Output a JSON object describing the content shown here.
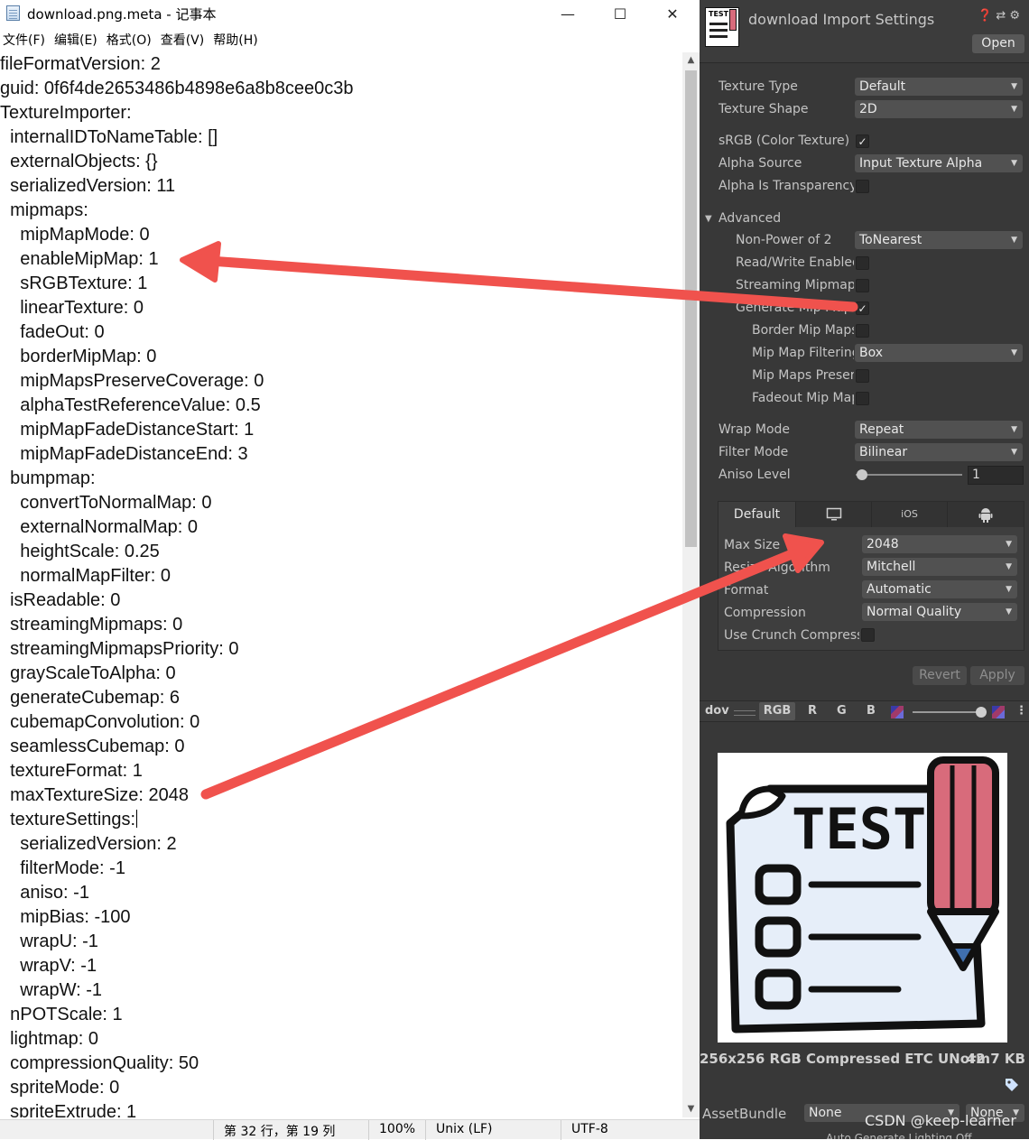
{
  "notepad": {
    "title": "download.png.meta - 记事本",
    "window_controls": {
      "minimize": "—",
      "maximize": "☐",
      "close": "✕"
    },
    "menu": [
      "文件(F)",
      "编辑(E)",
      "格式(O)",
      "查看(V)",
      "帮助(H)"
    ],
    "lines": [
      "fileFormatVersion: 2",
      "guid: 0f6f4de2653486b4898e6a8b8cee0c3b",
      "TextureImporter:",
      "  internalIDToNameTable: []",
      "  externalObjects: {}",
      "  serializedVersion: 11",
      "  mipmaps:",
      "    mipMapMode: 0",
      "    enableMipMap: 1",
      "    sRGBTexture: 1",
      "    linearTexture: 0",
      "    fadeOut: 0",
      "    borderMipMap: 0",
      "    mipMapsPreserveCoverage: 0",
      "    alphaTestReferenceValue: 0.5",
      "    mipMapFadeDistanceStart: 1",
      "    mipMapFadeDistanceEnd: 3",
      "  bumpmap:",
      "    convertToNormalMap: 0",
      "    externalNormalMap: 0",
      "    heightScale: 0.25",
      "    normalMapFilter: 0",
      "  isReadable: 0",
      "  streamingMipmaps: 0",
      "  streamingMipmapsPriority: 0",
      "  grayScaleToAlpha: 0",
      "  generateCubemap: 6",
      "  cubemapConvolution: 0",
      "  seamlessCubemap: 0",
      "  textureFormat: 1",
      "  maxTextureSize: 2048",
      "  textureSettings:",
      "    serializedVersion: 2",
      "    filterMode: -1",
      "    aniso: -1",
      "    mipBias: -100",
      "    wrapU: -1",
      "    wrapV: -1",
      "    wrapW: -1",
      "  nPOTScale: 1",
      "  lightmap: 0",
      "  compressionQuality: 50",
      "  spriteMode: 0",
      "  spriteExtrude: 1"
    ],
    "status": {
      "position": "第 32 行，第 19 列",
      "zoom": "100%",
      "line_ending": "Unix (LF)",
      "encoding": "UTF-8"
    }
  },
  "inspector": {
    "title": "download Import Settings",
    "header_icons": "❓ ⇄ ⚙",
    "open_button": "Open",
    "texture_type": {
      "label": "Texture Type",
      "value": "Default"
    },
    "texture_shape": {
      "label": "Texture Shape",
      "value": "2D"
    },
    "srgb": {
      "label": "sRGB (Color Texture)",
      "checked": true
    },
    "alpha_source": {
      "label": "Alpha Source",
      "value": "Input Texture Alpha"
    },
    "alpha_is_transparency": {
      "label": "Alpha Is Transparency",
      "checked": false
    },
    "advanced": {
      "label": "Advanced",
      "non_power_of_2": {
        "label": "Non-Power of 2",
        "value": "ToNearest"
      },
      "read_write": {
        "label": "Read/Write Enabled",
        "checked": false
      },
      "streaming_mipmaps": {
        "label": "Streaming Mipmaps",
        "checked": false
      },
      "generate_mipmaps": {
        "label": "Generate Mip Maps",
        "checked": true
      },
      "border_mipmaps": {
        "label": "Border Mip Maps",
        "checked": false
      },
      "mipmap_filtering": {
        "label": "Mip Map Filtering",
        "value": "Box"
      },
      "mipmaps_preserve": {
        "label": "Mip Maps Preserve Coverage",
        "checked": false
      },
      "fadeout_mipmaps": {
        "label": "Fadeout Mip Maps",
        "checked": false
      }
    },
    "wrap_mode": {
      "label": "Wrap Mode",
      "value": "Repeat"
    },
    "filter_mode": {
      "label": "Filter Mode",
      "value": "Bilinear"
    },
    "aniso_level": {
      "label": "Aniso Level",
      "value": "1",
      "slider_fraction": 0.06
    },
    "platform_tabs": {
      "default": "Default",
      "ios": "iOS",
      "pc_icon": "monitor-icon",
      "android_icon": "android-icon"
    },
    "max_size": {
      "label": "Max Size",
      "value": "2048"
    },
    "resize_algorithm": {
      "label": "Resize Algorithm",
      "value": "Mitchell"
    },
    "format": {
      "label": "Format",
      "value": "Automatic"
    },
    "compression": {
      "label": "Compression",
      "value": "Normal Quality"
    },
    "crunch": {
      "label": "Use Crunch Compression",
      "checked": false
    },
    "revert_button": "Revert",
    "apply_button": "Apply",
    "preview_toolbar": {
      "name": "dov",
      "channels": [
        "RGB",
        "R",
        "G",
        "B"
      ],
      "mip_fraction": 1.0,
      "menu": "⋮"
    },
    "preview_image": {
      "heading": "TEST"
    },
    "preview_info": {
      "size": "256x256  RGB Compressed ETC UNorm",
      "bytes": "42.7 KB"
    },
    "asset_bundle": {
      "label": "AssetBundle",
      "name": "None",
      "variant": "None"
    },
    "bottom_cut": "Auto Generate Lighting Off"
  },
  "colors": {
    "arrow": "#f0524d",
    "unity_bg": "#383838",
    "pencil_body": "#d86b7b",
    "pencil_tip": "#3f6fae"
  },
  "watermark": "CSDN @keep-learner"
}
